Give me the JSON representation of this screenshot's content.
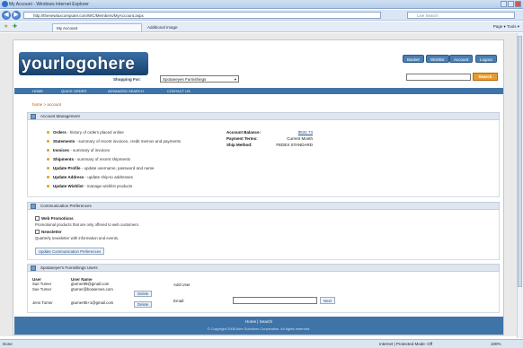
{
  "window": {
    "title": "My Account - Windows Internet Explorer"
  },
  "address": {
    "url": "http://thenewluxcomputer.com/WC/Members/MyAccount.aspx",
    "search_placeholder": "Live Search"
  },
  "tabs": [
    {
      "label": "My Account"
    },
    {
      "label": "Additional Image"
    }
  ],
  "commandbar": {
    "text": "Page ▾  Tools ▾"
  },
  "header": {
    "logo_text": "yourlogohere",
    "buttons": [
      "Basket",
      "Wishlist",
      "Account",
      "Logout"
    ],
    "shopping_for_label": "Shopping For:",
    "shopping_for_value": "Spotaneyes Furnishings",
    "search_button": "Search"
  },
  "nav": {
    "items": [
      "HOME",
      "QUICK ORDER",
      "ADVANCED SEARCH",
      "CONTACT US"
    ]
  },
  "breadcrumb": "home > account",
  "account_management": {
    "title": "Account Management",
    "items": [
      {
        "label": "Orders",
        "desc": " - history of orders placed online"
      },
      {
        "label": "Statements",
        "desc": " - summary of recent invoices, credit memos and payments"
      },
      {
        "label": "Invoices",
        "desc": " - summary of invoices"
      },
      {
        "label": "Shipments",
        "desc": " - summary of recent shipments"
      },
      {
        "label": "Update Profile",
        "desc": " - update username, password and name"
      },
      {
        "label": "Update Address",
        "desc": " - update ship-to addresses"
      },
      {
        "label": "Update Wishlist",
        "desc": " - manage wishlist products"
      }
    ],
    "balance_label": "Account Balance:",
    "balance_value": "$531.73",
    "terms_label": "Payment Terms:",
    "terms_value": "Current Month",
    "ship_label": "Ship Method:",
    "ship_value": "FEDEX STANDARD"
  },
  "comm_prefs": {
    "title": "Communication Preferences",
    "promo_label": "Web Promotions",
    "promo_desc": "Promotional products that are only offered to web customers.",
    "news_label": "Newsletter",
    "news_desc": "Quarterly newsletter with information and events.",
    "update_button": "Update Communication Preferences"
  },
  "users": {
    "title": "Spotaneyer's Furnishings Users",
    "col_user": "User",
    "col_username": "User Name",
    "rows": [
      {
        "user": "Sue Turner",
        "username": "gturner89@gmail.com",
        "delete": ""
      },
      {
        "user": "Sue Turner",
        "username": "gturner@bosserves.com",
        "delete": "Delete"
      },
      {
        "user": "Jens Turner",
        "username": "gturner85+1@gmail.com",
        "delete": "Delete"
      }
    ],
    "add_user_label": "Add User",
    "email_label": "Email:",
    "next_button": "Next"
  },
  "footer": {
    "links": "Home | Search",
    "copyright": "© Copyright 2008 Alex Solutions Corporation. All rights reserved."
  },
  "statusbar": {
    "left": "Done",
    "zone": "Internet | Protected Mode: Off",
    "zoom": "100%"
  }
}
